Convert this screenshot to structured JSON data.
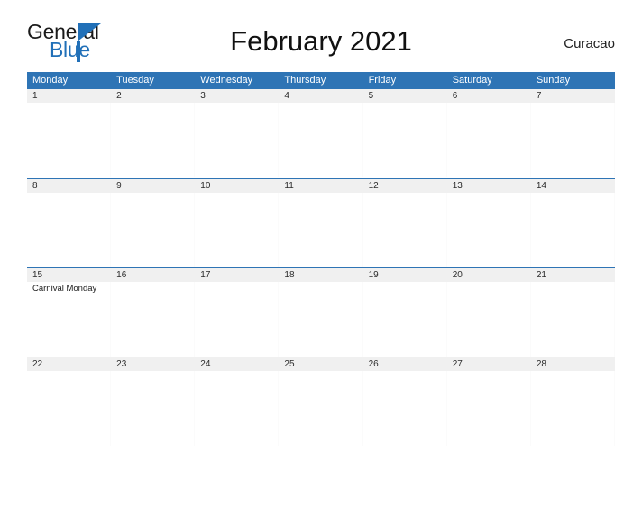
{
  "brand": {
    "word1": "General",
    "word2": "Blue",
    "triangle_color": "#2170b8",
    "text_color": "#1a1a1a"
  },
  "header": {
    "title": "February 2021",
    "country": "Curacao"
  },
  "theme": {
    "header_blue": "#2e74b5",
    "row_rule_blue": "#2e74b5",
    "date_band_gray": "#f0f0f0",
    "page_background": "#ffffff"
  },
  "calendar": {
    "month": "February",
    "year": "2021",
    "weekday_headers": [
      "Monday",
      "Tuesday",
      "Wednesday",
      "Thursday",
      "Friday",
      "Saturday",
      "Sunday"
    ],
    "weeks": [
      {
        "days": [
          {
            "date": "1",
            "events": []
          },
          {
            "date": "2",
            "events": []
          },
          {
            "date": "3",
            "events": []
          },
          {
            "date": "4",
            "events": []
          },
          {
            "date": "5",
            "events": []
          },
          {
            "date": "6",
            "events": []
          },
          {
            "date": "7",
            "events": []
          }
        ]
      },
      {
        "days": [
          {
            "date": "8",
            "events": []
          },
          {
            "date": "9",
            "events": []
          },
          {
            "date": "10",
            "events": []
          },
          {
            "date": "11",
            "events": []
          },
          {
            "date": "12",
            "events": []
          },
          {
            "date": "13",
            "events": []
          },
          {
            "date": "14",
            "events": []
          }
        ]
      },
      {
        "days": [
          {
            "date": "15",
            "events": [
              "Carnival Monday"
            ]
          },
          {
            "date": "16",
            "events": []
          },
          {
            "date": "17",
            "events": []
          },
          {
            "date": "18",
            "events": []
          },
          {
            "date": "19",
            "events": []
          },
          {
            "date": "20",
            "events": []
          },
          {
            "date": "21",
            "events": []
          }
        ]
      },
      {
        "days": [
          {
            "date": "22",
            "events": []
          },
          {
            "date": "23",
            "events": []
          },
          {
            "date": "24",
            "events": []
          },
          {
            "date": "25",
            "events": []
          },
          {
            "date": "26",
            "events": []
          },
          {
            "date": "27",
            "events": []
          },
          {
            "date": "28",
            "events": []
          }
        ]
      }
    ]
  }
}
